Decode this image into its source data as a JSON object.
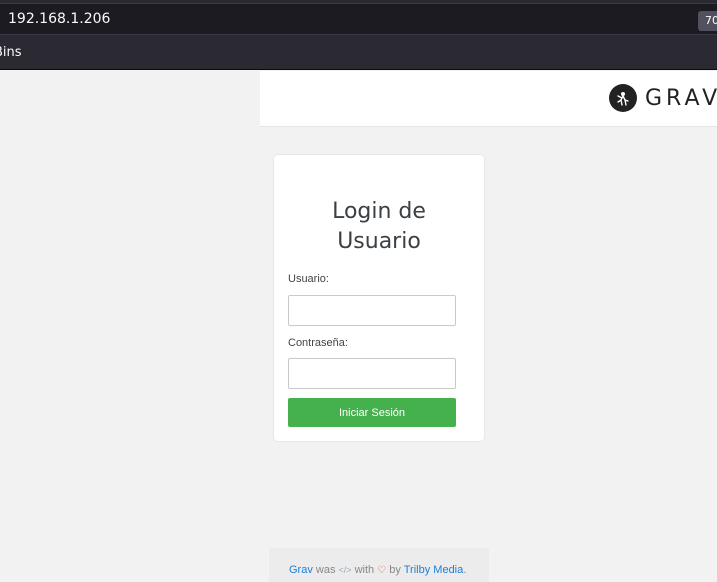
{
  "browser": {
    "url": "192.168.1.206",
    "zoom": "70",
    "bookmarks": [
      "Bins"
    ]
  },
  "header": {
    "logo_text": "GRAV"
  },
  "login": {
    "title_line1": "Login de",
    "title_line2": "Usuario",
    "username_label": "Usuario:",
    "username_value": "",
    "password_label": "Contraseña:",
    "password_value": "",
    "submit_label": "Iniciar Sesión"
  },
  "footer": {
    "grav_link": "Grav",
    "was": "was",
    "with": "with",
    "by": "by",
    "trilby_link": "Trilby Media",
    "period": "."
  },
  "colors": {
    "button_green": "#45b14c",
    "link_blue": "#1e7fd6",
    "heart": "#e9573f"
  }
}
